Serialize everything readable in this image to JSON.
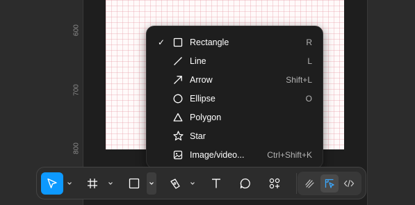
{
  "ruler": {
    "labels": [
      "600",
      "700",
      "800"
    ]
  },
  "shape_menu": {
    "items": [
      {
        "label": "Rectangle",
        "shortcut": "R",
        "icon": "rectangle-icon",
        "checked": true
      },
      {
        "label": "Line",
        "shortcut": "L",
        "icon": "line-icon",
        "checked": false
      },
      {
        "label": "Arrow",
        "shortcut": "Shift+L",
        "icon": "arrow-icon",
        "checked": false
      },
      {
        "label": "Ellipse",
        "shortcut": "O",
        "icon": "ellipse-icon",
        "checked": false
      },
      {
        "label": "Polygon",
        "shortcut": "",
        "icon": "polygon-icon",
        "checked": false
      },
      {
        "label": "Star",
        "shortcut": "",
        "icon": "star-icon",
        "checked": false
      },
      {
        "label": "Image/video...",
        "shortcut": "Ctrl+Shift+K",
        "icon": "image-icon",
        "checked": false
      }
    ],
    "check_glyph": "✓"
  },
  "toolbar": {
    "tools": [
      "move-tool",
      "frame-tool",
      "shape-tool",
      "pen-tool",
      "text-tool",
      "comment-tool",
      "actions-tool"
    ],
    "modes": [
      "draw-mode",
      "design-mode",
      "dev-mode"
    ],
    "active_tool": "move-tool",
    "selected_mode": "design-mode"
  },
  "colors": {
    "accent": "#0d99ff",
    "menu_bg": "#1e1e1e",
    "toolbar_bg": "#2c2c2c"
  }
}
